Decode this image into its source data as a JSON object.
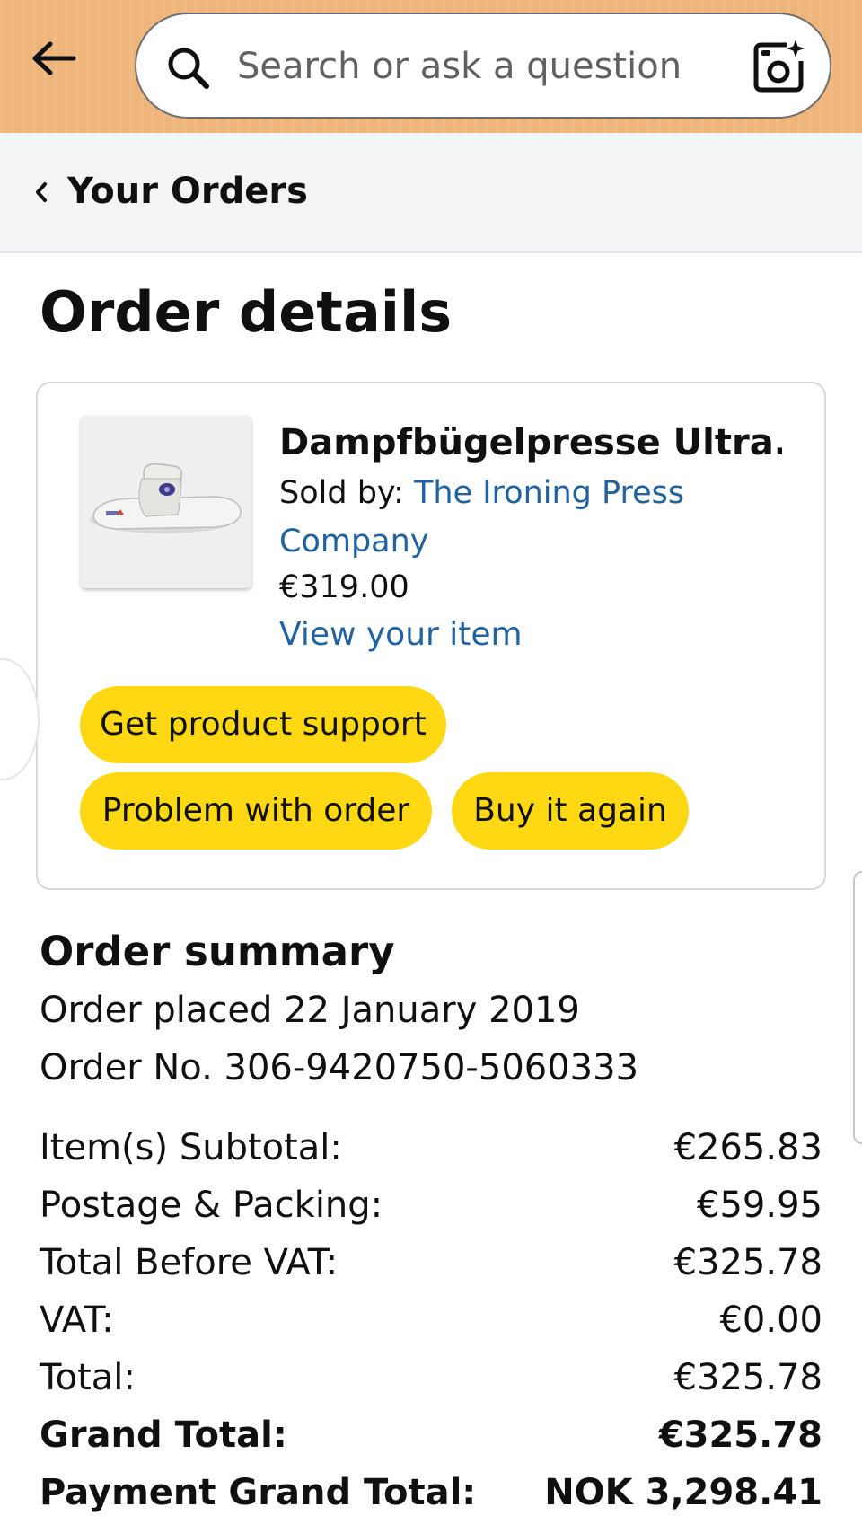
{
  "header": {
    "search_placeholder": "Search or ask a question",
    "icons": [
      "back-arrow-icon",
      "search-icon",
      "camera-icon"
    ],
    "background_color": "#efb47a"
  },
  "subnav": {
    "back_label": "Your Orders"
  },
  "page": {
    "title": "Order details"
  },
  "item": {
    "title": "Dampfbügelpresse Ultra...",
    "sold_by_prefix": "Sold by: ",
    "seller": "The Ironing Press Company",
    "price": "€319.00",
    "view_link": "View your item",
    "buttons": {
      "support": "Get product support",
      "problem": "Problem with order",
      "buy_again": "Buy it again"
    },
    "button_color": "#ffd814",
    "link_color": "#2162a1"
  },
  "summary": {
    "title": "Order summary",
    "order_placed": "Order placed 22 January 2019",
    "order_number": "Order No. 306-9420750-5060333",
    "rows": [
      {
        "label": "Item(s) Subtotal:",
        "value": "€265.83",
        "bold": false
      },
      {
        "label": "Postage & Packing:",
        "value": "€59.95",
        "bold": false
      },
      {
        "label": "Total Before VAT:",
        "value": "€325.78",
        "bold": false
      },
      {
        "label": "VAT:",
        "value": "€0.00",
        "bold": false
      },
      {
        "label": "Total:",
        "value": "€325.78",
        "bold": false
      },
      {
        "label": "Grand Total:",
        "value": "€325.78",
        "bold": true
      },
      {
        "label": "Payment Grand Total:",
        "value": "NOK 3,298.41",
        "bold": true
      }
    ]
  }
}
